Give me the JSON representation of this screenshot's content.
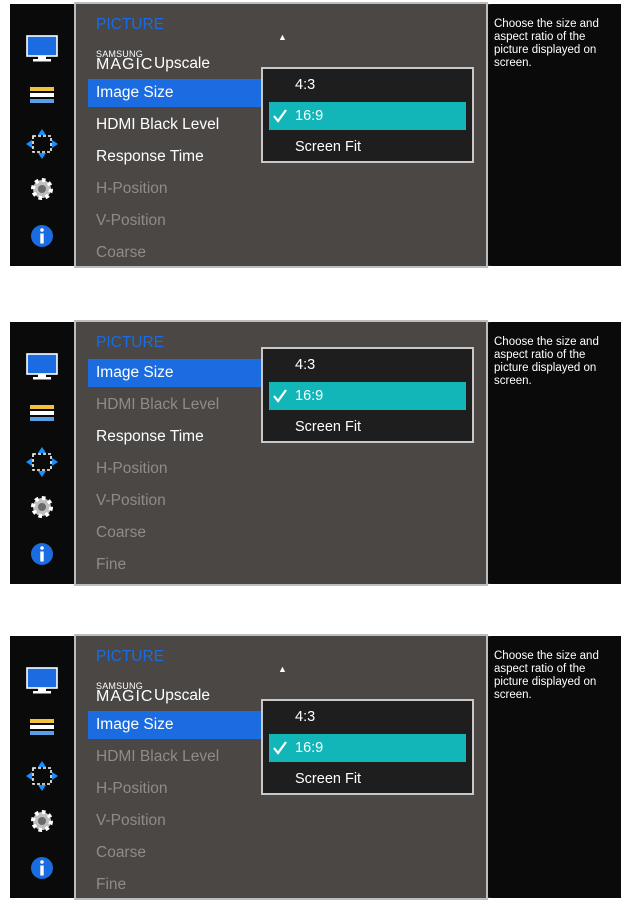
{
  "colors": {
    "accent": "#1a6ce0",
    "selected_option": "#12b5b8",
    "enabled_text": "#ffffff",
    "disabled_text": "#8e8c8a"
  },
  "panels": [
    {
      "icons": [
        "monitor-icon",
        "menu-bars-icon",
        "resize-arrows-icon",
        "gear-icon",
        "info-icon"
      ],
      "menu_title": "PICTURE",
      "magic": {
        "brand": "SAMSUNG",
        "word": "MAGIC",
        "label": "Upscale"
      },
      "items": [
        {
          "label": "Image Size",
          "state": "selected"
        },
        {
          "label": "HDMI Black Level",
          "state": "enabled"
        },
        {
          "label": "Response Time",
          "state": "enabled"
        },
        {
          "label": "H-Position",
          "state": "disabled"
        },
        {
          "label": "V-Position",
          "state": "disabled"
        },
        {
          "label": "Coarse",
          "state": "disabled"
        }
      ],
      "dropdown": {
        "options": [
          "4:3",
          "16:9",
          "Screen Fit"
        ],
        "selected": "16:9"
      },
      "help_text": "Choose the size and aspect ratio of the picture displayed on screen."
    },
    {
      "icons": [
        "monitor-icon",
        "menu-bars-icon",
        "resize-arrows-icon",
        "gear-icon",
        "info-icon"
      ],
      "menu_title": "PICTURE",
      "items": [
        {
          "label": "Image Size",
          "state": "selected"
        },
        {
          "label": "HDMI Black Level",
          "state": "disabled"
        },
        {
          "label": "Response Time",
          "state": "enabled"
        },
        {
          "label": "H-Position",
          "state": "disabled"
        },
        {
          "label": "V-Position",
          "state": "disabled"
        },
        {
          "label": "Coarse",
          "state": "disabled"
        },
        {
          "label": "Fine",
          "state": "disabled"
        }
      ],
      "dropdown": {
        "options": [
          "4:3",
          "16:9",
          "Screen Fit"
        ],
        "selected": "16:9"
      },
      "help_text": "Choose the size and aspect ratio of the picture displayed on screen."
    },
    {
      "icons": [
        "monitor-icon",
        "menu-bars-icon",
        "resize-arrows-icon",
        "gear-icon",
        "info-icon"
      ],
      "menu_title": "PICTURE",
      "magic": {
        "brand": "SAMSUNG",
        "word": "MAGIC",
        "label": "Upscale"
      },
      "items": [
        {
          "label": "Image Size",
          "state": "selected"
        },
        {
          "label": "HDMI Black Level",
          "state": "disabled"
        },
        {
          "label": "H-Position",
          "state": "disabled"
        },
        {
          "label": "V-Position",
          "state": "disabled"
        },
        {
          "label": "Coarse",
          "state": "disabled"
        },
        {
          "label": "Fine",
          "state": "disabled"
        }
      ],
      "dropdown": {
        "options": [
          "4:3",
          "16:9",
          "Screen Fit"
        ],
        "selected": "16:9"
      },
      "help_text": "Choose the size and aspect ratio of the picture displayed on screen."
    }
  ]
}
